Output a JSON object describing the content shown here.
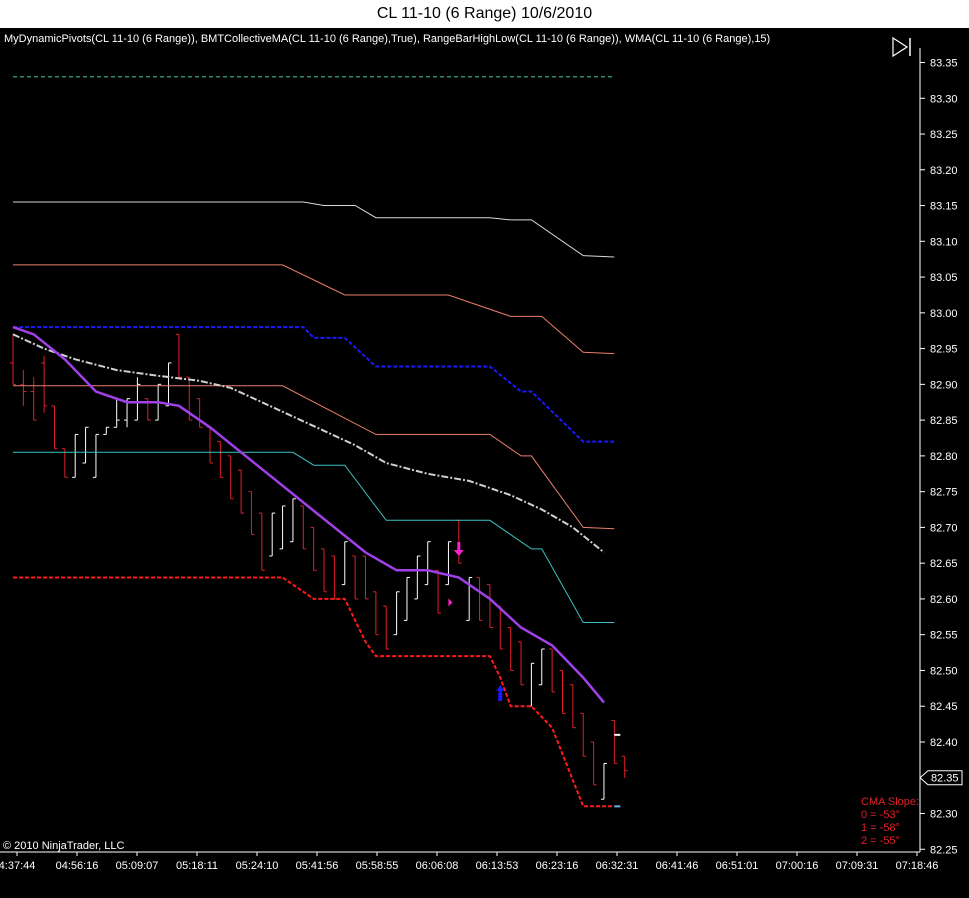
{
  "window": {
    "title": "CL 11-10 (6 Range)  10/6/2010",
    "indicators": "MyDynamicPivots(CL 11-10 (6 Range)), BMTCollectiveMA(CL 11-10 (6 Range),True), RangeBarHighLow(CL 11-10 (6 Range)), WMA(CL 11-10 (6 Range),15)",
    "copyright": "© 2010 NinjaTrader, LLC"
  },
  "slope_box": {
    "title": "CMA Slope:",
    "lines": [
      "0 = -53°",
      "1 = -58°",
      "2 = -55°"
    ]
  },
  "current_price_label": "82.35",
  "colors": {
    "background": "#000000",
    "up_bar": "#ffffff",
    "down_bar": "#e0202a",
    "pivot_top": "#2e8b6a",
    "r2": "#d8d8e0",
    "r1": "#e9806a",
    "blue_pivot": "#1a1aff",
    "cma": "#d0d0d0",
    "wma": "#a040e8",
    "s1": "#3cc0c0",
    "low_line": "#ff1a1a",
    "signal": "#ff20c8"
  },
  "icons": {
    "end_button": "skip-to-end-icon"
  },
  "chart_data": {
    "type": "line",
    "title": "CL 11-10 (6 Range)  10/6/2010",
    "ylim": [
      82.25,
      83.37
    ],
    "y_ticks": [
      "83.35",
      "83.30",
      "83.25",
      "83.20",
      "83.15",
      "83.10",
      "83.05",
      "83.00",
      "82.95",
      "82.90",
      "82.85",
      "82.80",
      "82.75",
      "82.70",
      "82.65",
      "82.60",
      "82.55",
      "82.50",
      "82.45",
      "82.40",
      "82.35",
      "82.30",
      "82.25"
    ],
    "x_ticks": [
      "4:37:44",
      "04:56:16",
      "05:09:07",
      "05:18:11",
      "05:24:10",
      "05:41:56",
      "05:58:55",
      "06:06:08",
      "06:13:53",
      "06:23:16",
      "06:32:31",
      "06:41:46",
      "06:51:01",
      "07:00:16",
      "07:09:31",
      "07:18:46"
    ],
    "n_slots": 87,
    "bars": [
      {
        "o": 82.93,
        "h": 82.97,
        "l": 82.9,
        "c": 82.9
      },
      {
        "o": 82.9,
        "h": 82.92,
        "l": 82.87,
        "c": 82.89
      },
      {
        "o": 82.89,
        "h": 82.91,
        "l": 82.85,
        "c": 82.85
      },
      {
        "o": 82.93,
        "h": 82.94,
        "l": 82.86,
        "c": 82.87
      },
      {
        "o": 82.87,
        "h": 82.87,
        "l": 82.81,
        "c": 82.81
      },
      {
        "o": 82.81,
        "h": 82.81,
        "l": 82.77,
        "c": 82.77
      },
      {
        "o": 82.77,
        "h": 82.83,
        "l": 82.77,
        "c": 82.83
      },
      {
        "o": 82.79,
        "h": 82.84,
        "l": 82.79,
        "c": 82.84
      },
      {
        "o": 82.77,
        "h": 82.83,
        "l": 82.77,
        "c": 82.83
      },
      {
        "o": 82.83,
        "h": 82.84,
        "l": 82.83,
        "c": 82.84
      },
      {
        "o": 82.84,
        "h": 82.88,
        "l": 82.84,
        "c": 82.85
      },
      {
        "o": 82.85,
        "h": 82.88,
        "l": 82.84,
        "c": 82.88
      },
      {
        "o": 82.85,
        "h": 82.91,
        "l": 82.85,
        "c": 82.9
      },
      {
        "o": 82.88,
        "h": 82.88,
        "l": 82.85,
        "c": 82.85
      },
      {
        "o": 82.85,
        "h": 82.9,
        "l": 82.85,
        "c": 82.9
      },
      {
        "o": 82.87,
        "h": 82.93,
        "l": 82.87,
        "c": 82.93
      },
      {
        "o": 82.97,
        "h": 82.97,
        "l": 82.91,
        "c": 82.91
      },
      {
        "o": 82.91,
        "h": 82.91,
        "l": 82.85,
        "c": 82.85
      },
      {
        "o": 82.88,
        "h": 82.88,
        "l": 82.84,
        "c": 82.84
      },
      {
        "o": 82.84,
        "h": 82.84,
        "l": 82.79,
        "c": 82.79
      },
      {
        "o": 82.82,
        "h": 82.82,
        "l": 82.77,
        "c": 82.77
      },
      {
        "o": 82.8,
        "h": 82.8,
        "l": 82.74,
        "c": 82.74
      },
      {
        "o": 82.78,
        "h": 82.78,
        "l": 82.72,
        "c": 82.72
      },
      {
        "o": 82.75,
        "h": 82.75,
        "l": 82.69,
        "c": 82.69
      },
      {
        "o": 82.72,
        "h": 82.72,
        "l": 82.64,
        "c": 82.64
      },
      {
        "o": 82.66,
        "h": 82.72,
        "l": 82.66,
        "c": 82.72
      },
      {
        "o": 82.67,
        "h": 82.73,
        "l": 82.67,
        "c": 82.73
      },
      {
        "o": 82.68,
        "h": 82.74,
        "l": 82.68,
        "c": 82.74
      },
      {
        "o": 82.73,
        "h": 82.73,
        "l": 82.67,
        "c": 82.67
      },
      {
        "o": 82.7,
        "h": 82.7,
        "l": 82.64,
        "c": 82.64
      },
      {
        "o": 82.67,
        "h": 82.67,
        "l": 82.61,
        "c": 82.61
      },
      {
        "o": 82.66,
        "h": 82.66,
        "l": 82.6,
        "c": 82.6
      },
      {
        "o": 82.62,
        "h": 82.68,
        "l": 82.62,
        "c": 82.68
      },
      {
        "o": 82.66,
        "h": 82.66,
        "l": 82.6,
        "c": 82.6
      },
      {
        "o": 82.66,
        "h": 82.66,
        "l": 82.6,
        "c": 82.6
      },
      {
        "o": 82.61,
        "h": 82.61,
        "l": 82.55,
        "c": 82.55
      },
      {
        "o": 82.59,
        "h": 82.59,
        "l": 82.53,
        "c": 82.53
      },
      {
        "o": 82.55,
        "h": 82.61,
        "l": 82.55,
        "c": 82.61
      },
      {
        "o": 82.57,
        "h": 82.63,
        "l": 82.57,
        "c": 82.63
      },
      {
        "o": 82.6,
        "h": 82.66,
        "l": 82.6,
        "c": 82.66
      },
      {
        "o": 82.62,
        "h": 82.68,
        "l": 82.62,
        "c": 82.68
      },
      {
        "o": 82.64,
        "h": 82.64,
        "l": 82.58,
        "c": 82.58
      },
      {
        "o": 82.62,
        "h": 82.68,
        "l": 82.62,
        "c": 82.68
      },
      {
        "o": 82.71,
        "h": 82.71,
        "l": 82.65,
        "c": 82.65
      },
      {
        "o": 82.57,
        "h": 82.63,
        "l": 82.57,
        "c": 82.63
      },
      {
        "o": 82.63,
        "h": 82.63,
        "l": 82.57,
        "c": 82.57
      },
      {
        "o": 82.62,
        "h": 82.62,
        "l": 82.56,
        "c": 82.56
      },
      {
        "o": 82.59,
        "h": 82.59,
        "l": 82.53,
        "c": 82.53
      },
      {
        "o": 82.56,
        "h": 82.56,
        "l": 82.5,
        "c": 82.5
      },
      {
        "o": 82.54,
        "h": 82.54,
        "l": 82.48,
        "c": 82.48
      },
      {
        "o": 82.45,
        "h": 82.51,
        "l": 82.45,
        "c": 82.51
      },
      {
        "o": 82.48,
        "h": 82.53,
        "l": 82.48,
        "c": 82.53
      },
      {
        "o": 82.53,
        "h": 82.53,
        "l": 82.47,
        "c": 82.47
      },
      {
        "o": 82.5,
        "h": 82.5,
        "l": 82.44,
        "c": 82.44
      },
      {
        "o": 82.48,
        "h": 82.48,
        "l": 82.42,
        "c": 82.42
      },
      {
        "o": 82.44,
        "h": 82.44,
        "l": 82.38,
        "c": 82.38
      },
      {
        "o": 82.4,
        "h": 82.4,
        "l": 82.34,
        "c": 82.34
      },
      {
        "o": 82.32,
        "h": 82.37,
        "l": 82.32,
        "c": 82.37
      },
      {
        "o": 82.43,
        "h": 82.43,
        "l": 82.37,
        "c": 82.37
      },
      {
        "o": 82.38,
        "h": 82.38,
        "l": 82.35,
        "c": 82.36
      }
    ],
    "series": [
      {
        "style": "pivot_top",
        "values": [
          [
            0,
            83.33
          ],
          [
            58,
            83.33
          ]
        ]
      },
      {
        "style": "r2",
        "values": [
          [
            0,
            83.155
          ],
          [
            28,
            83.155
          ],
          [
            30,
            83.15
          ],
          [
            33,
            83.15
          ],
          [
            35,
            83.133
          ],
          [
            46,
            83.133
          ],
          [
            48,
            83.13
          ],
          [
            50,
            83.13
          ],
          [
            55,
            83.08
          ],
          [
            58,
            83.078
          ]
        ]
      },
      {
        "style": "r1",
        "values": [
          [
            0,
            83.067
          ],
          [
            26,
            83.067
          ],
          [
            32,
            83.025
          ],
          [
            42,
            83.025
          ],
          [
            48,
            82.995
          ],
          [
            51,
            82.995
          ],
          [
            55,
            82.945
          ],
          [
            58,
            82.943
          ]
        ]
      },
      {
        "style": "blue_pivot",
        "values": [
          [
            0,
            82.98
          ],
          [
            28,
            82.98
          ],
          [
            29,
            82.965
          ],
          [
            32,
            82.965
          ],
          [
            35,
            82.925
          ],
          [
            46,
            82.925
          ],
          [
            49,
            82.89
          ],
          [
            50,
            82.89
          ],
          [
            55,
            82.82
          ],
          [
            58,
            82.82
          ]
        ]
      },
      {
        "style": "r1",
        "values": [
          [
            0,
            82.898
          ],
          [
            26,
            82.898
          ],
          [
            35,
            82.83
          ],
          [
            46,
            82.83
          ],
          [
            49,
            82.8
          ],
          [
            50,
            82.8
          ],
          [
            55,
            82.7
          ],
          [
            58,
            82.698
          ]
        ]
      },
      {
        "style": "s1",
        "values": [
          [
            0,
            82.805
          ],
          [
            27,
            82.805
          ],
          [
            29,
            82.787
          ],
          [
            32,
            82.787
          ],
          [
            36,
            82.71
          ],
          [
            46,
            82.71
          ],
          [
            50,
            82.67
          ],
          [
            51,
            82.67
          ],
          [
            55,
            82.567
          ],
          [
            58,
            82.567
          ]
        ]
      },
      {
        "style": "cma",
        "values": [
          [
            0,
            82.97
          ],
          [
            3,
            82.95
          ],
          [
            6,
            82.935
          ],
          [
            10,
            82.92
          ],
          [
            14,
            82.912
          ],
          [
            18,
            82.905
          ],
          [
            21,
            82.895
          ],
          [
            24,
            82.875
          ],
          [
            27,
            82.855
          ],
          [
            30,
            82.835
          ],
          [
            33,
            82.815
          ],
          [
            36,
            82.79
          ],
          [
            40,
            82.775
          ],
          [
            44,
            82.765
          ],
          [
            48,
            82.745
          ],
          [
            51,
            82.725
          ],
          [
            54,
            82.7
          ],
          [
            57,
            82.665
          ]
        ]
      },
      {
        "style": "wma",
        "values": [
          [
            0,
            82.98
          ],
          [
            2,
            82.97
          ],
          [
            5,
            82.935
          ],
          [
            8,
            82.89
          ],
          [
            11,
            82.875
          ],
          [
            14,
            82.875
          ],
          [
            16,
            82.87
          ],
          [
            19,
            82.84
          ],
          [
            22,
            82.805
          ],
          [
            25,
            82.77
          ],
          [
            28,
            82.735
          ],
          [
            31,
            82.7
          ],
          [
            34,
            82.665
          ],
          [
            37,
            82.64
          ],
          [
            40,
            82.64
          ],
          [
            43,
            82.63
          ],
          [
            46,
            82.6
          ],
          [
            49,
            82.56
          ],
          [
            52,
            82.535
          ],
          [
            55,
            82.49
          ],
          [
            57,
            82.455
          ]
        ]
      },
      {
        "style": "low_line",
        "values": [
          [
            0,
            82.63
          ],
          [
            26,
            82.63
          ],
          [
            29,
            82.6
          ],
          [
            32,
            82.6
          ],
          [
            34,
            82.54
          ],
          [
            35,
            82.52
          ],
          [
            46,
            82.52
          ],
          [
            47,
            82.49
          ],
          [
            48,
            82.45
          ],
          [
            50,
            82.45
          ],
          [
            52,
            82.42
          ],
          [
            55,
            82.31
          ],
          [
            58,
            82.31
          ]
        ]
      }
    ],
    "signals": [
      {
        "type": "down-arrow",
        "slot": 43,
        "price": 82.66,
        "color": "signal"
      },
      {
        "type": "diamond",
        "slot": 42,
        "price": 82.595,
        "color": "signal"
      },
      {
        "type": "up-arrow",
        "slot": 47,
        "price": 82.46,
        "color": "blue_pivot"
      }
    ],
    "price_markers": [
      {
        "slot": 58,
        "price": 82.41,
        "color": "#ffffff"
      },
      {
        "slot": 58,
        "price": 82.31,
        "color": "#6ab0ff"
      }
    ]
  }
}
